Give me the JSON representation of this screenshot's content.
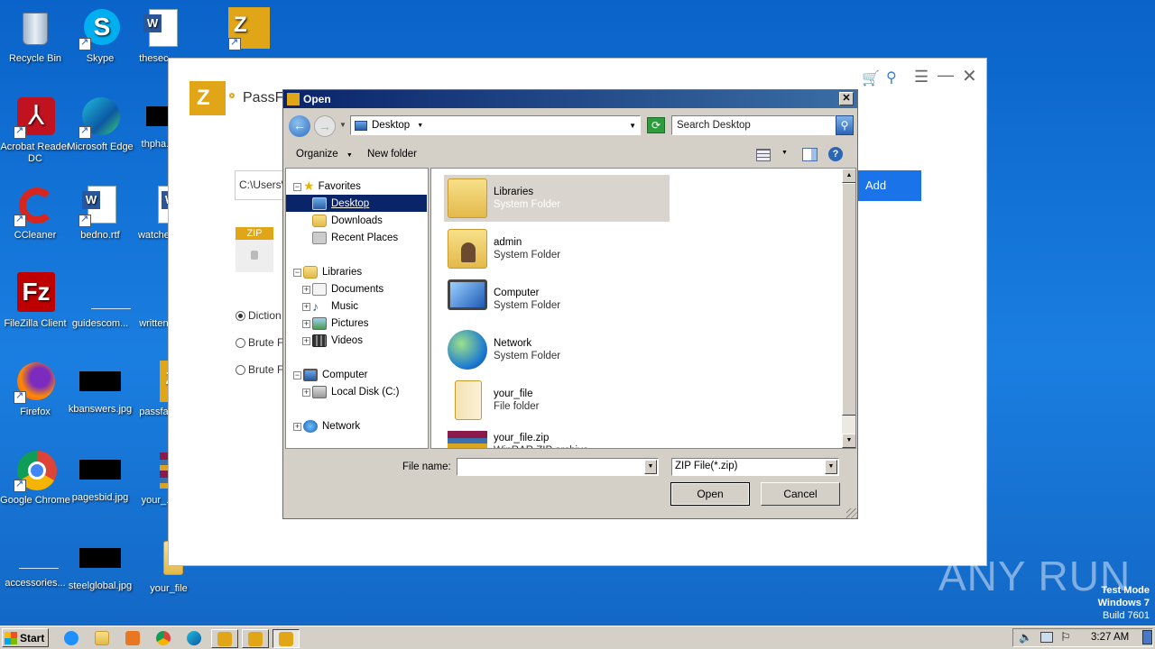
{
  "desktop": {
    "icons": [
      {
        "label": "Recycle Bin",
        "icon": "recycle-bin-icon"
      },
      {
        "label": "Skype",
        "icon": "skype-icon"
      },
      {
        "label": "thesec...",
        "icon": "word-doc-icon"
      },
      {
        "label": "PassFab",
        "icon": "passfab-icon"
      },
      {
        "label": "Acrobat Reader DC",
        "icon": "acrobat-icon"
      },
      {
        "label": "Microsoft Edge",
        "icon": "edge-icon"
      },
      {
        "label": "thpha...",
        "icon": "image-thumb-icon"
      },
      {
        "label": "CCleaner",
        "icon": "ccleaner-icon"
      },
      {
        "label": "bedno.rtf",
        "icon": "word-doc-icon"
      },
      {
        "label": "watche...",
        "icon": "word-doc-icon"
      },
      {
        "label": "FileZilla Client",
        "icon": "filezilla-icon"
      },
      {
        "label": "guidescom...",
        "icon": "blank-file-icon"
      },
      {
        "label": "written...",
        "icon": "blank-file-icon"
      },
      {
        "label": "Firefox",
        "icon": "firefox-icon"
      },
      {
        "label": "kbanswers.jpg",
        "icon": "image-thumb-icon"
      },
      {
        "label": "passfa...",
        "icon": "passfab-icon"
      },
      {
        "label": "Google Chrome",
        "icon": "chrome-icon"
      },
      {
        "label": "pagesbid.jpg",
        "icon": "image-thumb-icon"
      },
      {
        "label": "your_...",
        "icon": "winrar-icon"
      },
      {
        "label": "accessories...",
        "icon": "blank-file-icon"
      },
      {
        "label": "steelglobal.jpg",
        "icon": "image-thumb-icon"
      },
      {
        "label": "your_file",
        "icon": "folder-icon"
      }
    ]
  },
  "app": {
    "title": "PassFa",
    "path_value": "C:\\Users\\",
    "add_label": "Add",
    "zip_badge": "ZIP",
    "options": [
      "Diction",
      "Brute F",
      "Brute F"
    ]
  },
  "dialog": {
    "title": "Open",
    "location": "Desktop",
    "search_placeholder": "Search Desktop",
    "organize_label": "Organize",
    "new_folder_label": "New folder",
    "tree": [
      {
        "label": "Favorites",
        "icon": "star-icon"
      },
      {
        "label": "Desktop",
        "icon": "desktop-icon"
      },
      {
        "label": "Downloads",
        "icon": "downloads-icon"
      },
      {
        "label": "Recent Places",
        "icon": "recent-places-icon"
      },
      {
        "label": "Libraries",
        "icon": "libraries-icon"
      },
      {
        "label": "Documents",
        "icon": "documents-icon"
      },
      {
        "label": "Music",
        "icon": "music-icon"
      },
      {
        "label": "Pictures",
        "icon": "pictures-icon"
      },
      {
        "label": "Videos",
        "icon": "videos-icon"
      },
      {
        "label": "Computer",
        "icon": "computer-icon"
      },
      {
        "label": "Local Disk (C:)",
        "icon": "disk-icon"
      },
      {
        "label": "Network",
        "icon": "network-icon"
      }
    ],
    "files": [
      {
        "name": "Libraries",
        "type": "System Folder"
      },
      {
        "name": "admin",
        "type": "System Folder"
      },
      {
        "name": "Computer",
        "type": "System Folder"
      },
      {
        "name": "Network",
        "type": "System Folder"
      },
      {
        "name": "your_file",
        "type": "File folder"
      },
      {
        "name": "your_file.zip",
        "type": "WinRAR ZIP archive"
      }
    ],
    "file_name_label": "File name:",
    "file_name_value": "",
    "filter_value": "ZIP File(*.zip)",
    "open_label": "Open",
    "cancel_label": "Cancel"
  },
  "watermark": {
    "brand": "ANY RUN",
    "test_mode": "Test Mode",
    "os": "Windows 7",
    "build": "Build 7601"
  },
  "taskbar": {
    "start_label": "Start",
    "clock": "3:27 AM"
  }
}
